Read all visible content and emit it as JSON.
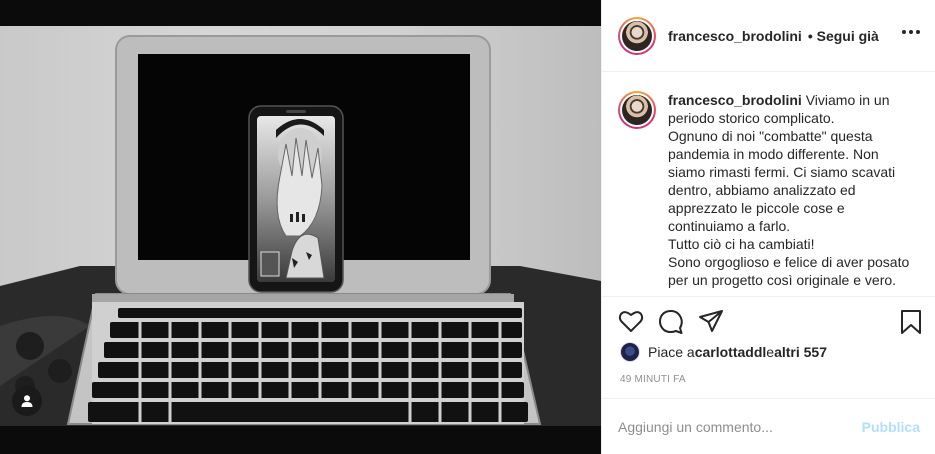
{
  "post": {
    "username": "francesco_brodolini",
    "follow_status": "• Segui già",
    "caption_lines": [
      "Viviamo in un",
      "periodo storico complicato.",
      "Ognuno di noi \"combatte\" questa",
      "pandemia in modo differente. Non",
      "siamo rimasti fermi. Ci siamo scavati",
      "dentro, abbiamo analizzato ed",
      "apprezzato le piccole cose e",
      "continuiamo a farlo.",
      "Tutto ciò ci ha cambiati!",
      "Sono orgoglioso e felice di aver posato",
      "per un progetto così originale e vero."
    ],
    "likes": {
      "prefix": "Piace a ",
      "user": "carlottaddl",
      "middle": " e ",
      "others": "altri 557"
    },
    "timestamp": "49 minuti fa",
    "comment": {
      "placeholder": "Aggiungi un commento...",
      "publish_label": "Pubblica"
    }
  },
  "icons": {
    "more": "more-horizontal-icon",
    "like": "heart-icon",
    "comment": "comment-icon",
    "share": "send-icon",
    "save": "bookmark-icon",
    "user_tag": "user-tag-icon"
  },
  "colors": {
    "publish_disabled": "#b2dffc",
    "story_ring": "#e1306c",
    "secondary_text": "#8e8e8e"
  }
}
